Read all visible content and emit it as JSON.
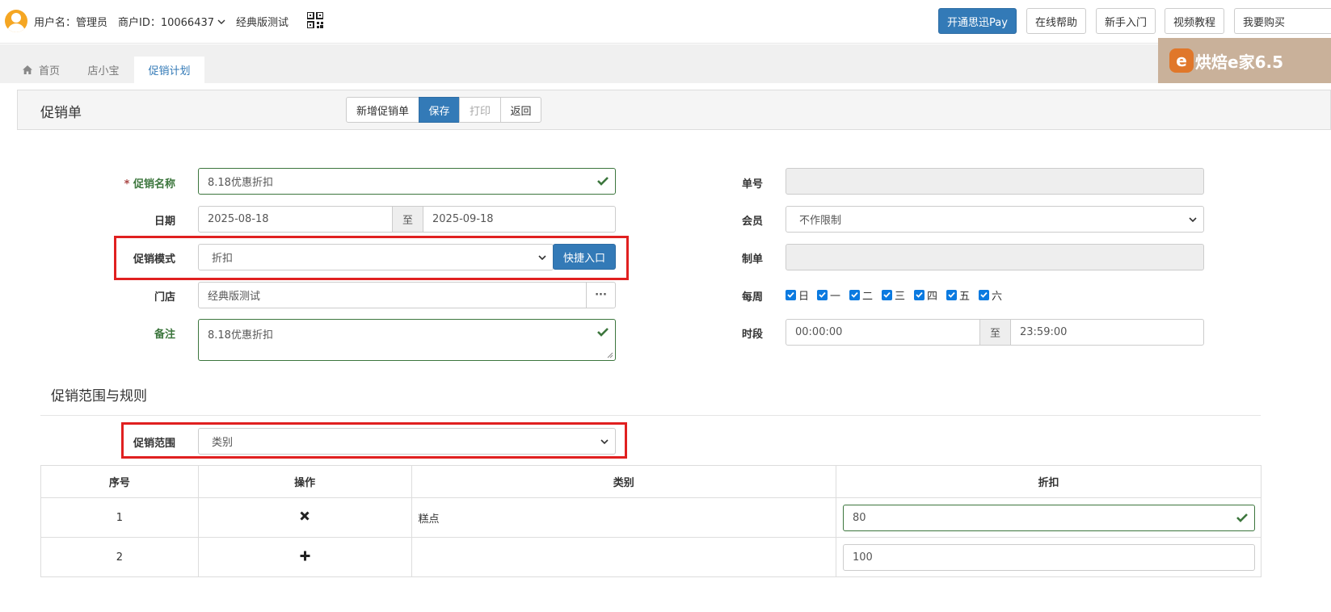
{
  "header": {
    "username_label": "用户名：管理员",
    "merchant_label": "商户ID：10066437",
    "store_name": "经典版测试",
    "buttons": [
      "开通思迅Pay",
      "在线帮助",
      "新手入门",
      "视频教程",
      "我要购买"
    ]
  },
  "tabs": [
    {
      "label": "首页",
      "icon": "home-icon"
    },
    {
      "label": "店小宝"
    },
    {
      "label": "促销计划",
      "active": true
    }
  ],
  "ad_banner": {
    "text": "烘焙e家6.5",
    "logo_letter": "e"
  },
  "panel": {
    "title": "促销单",
    "buttons": {
      "new": "新增促销单",
      "save": "保存",
      "print": "打印",
      "back": "返回"
    }
  },
  "form": {
    "name": {
      "label": "促销名称",
      "required_mark": "*",
      "value": "8.18优惠折扣"
    },
    "date": {
      "label": "日期",
      "from": "2025-08-18",
      "sep": "至",
      "to": "2025-09-18"
    },
    "mode": {
      "label": "促销模式",
      "value": "折扣",
      "quick_button": "快捷入口"
    },
    "store": {
      "label": "门店",
      "value": "经典版测试",
      "picker": "···"
    },
    "remark": {
      "label": "备注",
      "value": "8.18优惠折扣"
    },
    "order_no": {
      "label": "单号",
      "value": ""
    },
    "member": {
      "label": "会员",
      "value": "不作限制"
    },
    "maker": {
      "label": "制单",
      "value": ""
    },
    "weekly": {
      "label": "每周",
      "days": [
        "日",
        "一",
        "二",
        "三",
        "四",
        "五",
        "六"
      ]
    },
    "time": {
      "label": "时段",
      "from": "00:00:00",
      "sep": "至",
      "to": "23:59:00"
    }
  },
  "scope_section": {
    "title": "促销范围与规则",
    "scope": {
      "label": "促销范围",
      "value": "类别"
    }
  },
  "table": {
    "headers": [
      "序号",
      "操作",
      "类别",
      "折扣"
    ],
    "rows": [
      {
        "index": "1",
        "op_icon": "remove-icon",
        "category": "糕点",
        "discount": "80"
      },
      {
        "index": "2",
        "op_icon": "add-icon",
        "category": "",
        "discount": "100"
      }
    ]
  },
  "colors": {
    "primary": "#337ab7",
    "success": "#3c763d",
    "highlight": "#e02020"
  }
}
